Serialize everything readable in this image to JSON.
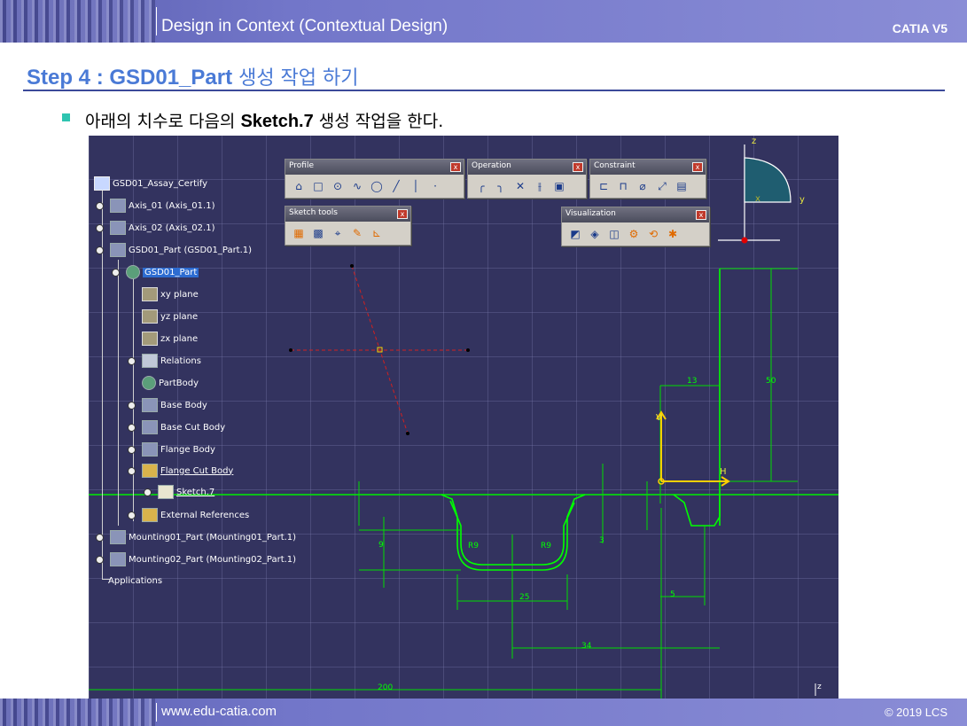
{
  "header": {
    "title": "Design in Context (Contextual Design)",
    "brand": "CATIA V5"
  },
  "step": {
    "title_en": "Step 4 : GSD01_Part",
    "title_kr": " 생성 작업 하기"
  },
  "instruction": {
    "pre": "아래의 치수로 다음의 ",
    "bold": "Sketch.7",
    "post": " 생성 작업을 한다."
  },
  "tree": {
    "items": [
      {
        "label": "GSD01_Assay_Certify"
      },
      {
        "label": "Axis_01 (Axis_01.1)"
      },
      {
        "label": "Axis_02 (Axis_02.1)"
      },
      {
        "label": "GSD01_Part (GSD01_Part.1)"
      },
      {
        "label": "GSD01_Part"
      },
      {
        "label": "xy plane"
      },
      {
        "label": "yz plane"
      },
      {
        "label": "zx plane"
      },
      {
        "label": "Relations"
      },
      {
        "label": "PartBody"
      },
      {
        "label": "Base Body"
      },
      {
        "label": "Base Cut Body"
      },
      {
        "label": "Flange Body"
      },
      {
        "label": "Flange Cut Body"
      },
      {
        "label": "Sketch.7"
      },
      {
        "label": "External References"
      },
      {
        "label": "Mounting01_Part (Mounting01_Part.1)"
      },
      {
        "label": "Mounting02_Part (Mounting02_Part.1)"
      },
      {
        "label": "Applications"
      }
    ]
  },
  "toolbars": {
    "profile": "Profile",
    "operation": "Operation",
    "constraint": "Constraint",
    "sketch_tools": "Sketch tools",
    "visualization": "Visualization",
    "close": "x"
  },
  "compass": {
    "z": "z",
    "y": "y",
    "x": "x"
  },
  "sketch_axes": {
    "v": "V",
    "h": "H"
  },
  "dimensions": {
    "d13": "13",
    "d50": "50",
    "d25": "25",
    "d34": "34",
    "d5": "5",
    "d200": "200",
    "d9": "9",
    "d3": "3",
    "r9a": "R9",
    "r9b": "R9"
  },
  "viewport_corner_axis": "z",
  "footer": {
    "left": "www.edu-catia.com",
    "right": "© 2019 LCS"
  },
  "colors": {
    "accent_title": "#4a7ad6",
    "bar": "#7276c9",
    "viewport_bg": "#33335f",
    "sketch_green": "#00ff00",
    "axis_yellow": "#e8e840"
  }
}
